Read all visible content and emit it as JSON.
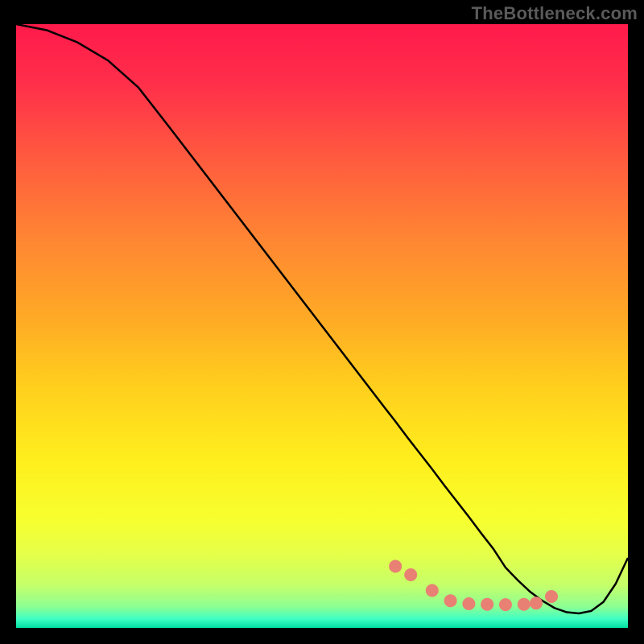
{
  "watermark": "TheBottleneck.com",
  "chart_data": {
    "type": "line",
    "title": "",
    "xlabel": "",
    "ylabel": "",
    "xlim": [
      0,
      100
    ],
    "ylim": [
      0,
      100
    ],
    "grid": false,
    "legend": false,
    "series": [
      {
        "name": "curve",
        "x": [
          0,
          5,
          10,
          15,
          20,
          25,
          30,
          35,
          40,
          45,
          50,
          55,
          60,
          62,
          64,
          66,
          68,
          70,
          72,
          74,
          76,
          78,
          80,
          82,
          84,
          86,
          88,
          90,
          92,
          94,
          96,
          98,
          100
        ],
        "values": [
          100,
          99,
          97,
          94,
          89.5,
          83,
          76.4,
          69.8,
          63.2,
          56.6,
          50,
          43.4,
          36.8,
          34.2,
          31.5,
          28.9,
          26.3,
          23.6,
          21,
          18.4,
          15.7,
          13.1,
          10,
          7.9,
          6.0,
          4.5,
          3.3,
          2.6,
          2.4,
          2.8,
          4.3,
          7.3,
          11.6
        ]
      }
    ],
    "markers": {
      "name": "marker-dots",
      "x": [
        62,
        64.5,
        68,
        71,
        74,
        77,
        80,
        83,
        85,
        87.5
      ],
      "values": [
        10.2,
        8.8,
        6.2,
        4.5,
        4.0,
        3.9,
        3.85,
        3.9,
        4.1,
        5.2
      ],
      "color": "#e98074",
      "radius": 8
    },
    "gradient_stops": [
      {
        "offset": 0.0,
        "color": "#ff1a4b"
      },
      {
        "offset": 0.1,
        "color": "#ff2f4a"
      },
      {
        "offset": 0.22,
        "color": "#ff5a3f"
      },
      {
        "offset": 0.35,
        "color": "#ff8433"
      },
      {
        "offset": 0.48,
        "color": "#ffa826"
      },
      {
        "offset": 0.6,
        "color": "#ffcf1d"
      },
      {
        "offset": 0.72,
        "color": "#ffee1d"
      },
      {
        "offset": 0.82,
        "color": "#f7ff2e"
      },
      {
        "offset": 0.88,
        "color": "#e4ff4a"
      },
      {
        "offset": 0.93,
        "color": "#c4ff6a"
      },
      {
        "offset": 0.965,
        "color": "#8cff93"
      },
      {
        "offset": 0.985,
        "color": "#3fffc4"
      },
      {
        "offset": 1.0,
        "color": "#00e0a0"
      }
    ]
  }
}
